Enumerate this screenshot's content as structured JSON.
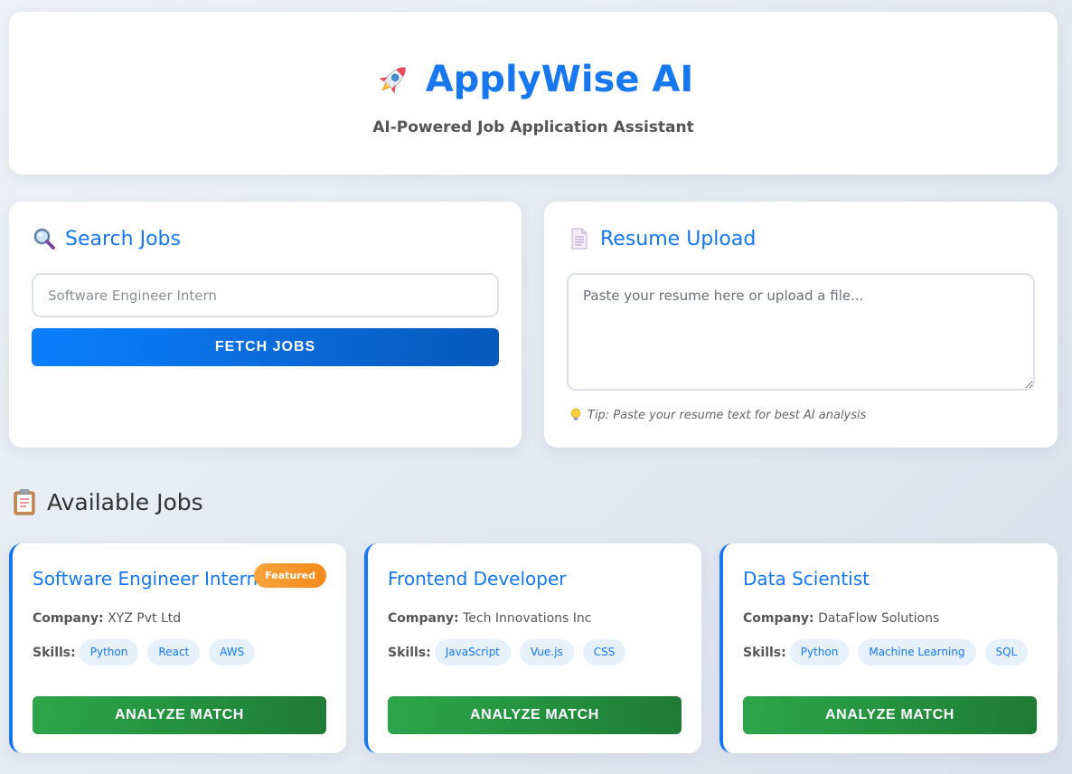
{
  "header": {
    "title": "ApplyWise AI",
    "subtitle": "AI-Powered Job Application Assistant",
    "icon": "rocket-icon"
  },
  "search": {
    "title": "Search Jobs",
    "icon": "magnifier-icon",
    "placeholder": "Software Engineer Intern",
    "value": "",
    "button_label": "FETCH JOBS"
  },
  "resume": {
    "title": "Resume Upload",
    "icon": "document-icon",
    "placeholder": "Paste your resume here or upload a file...",
    "tip": "Tip: Paste your resume text for best AI analysis",
    "tip_icon": "lightbulb-icon"
  },
  "jobs": {
    "heading": "Available Jobs",
    "icon": "clipboard-icon",
    "company_label": "Company:",
    "skills_label": "Skills:",
    "button_label": "ANALYZE MATCH",
    "items": [
      {
        "title": "Software Engineer Intern",
        "badge": "Featured",
        "company": "XYZ Pvt Ltd",
        "skills": [
          "Python",
          "React",
          "AWS"
        ]
      },
      {
        "title": "Frontend Developer",
        "company": "Tech Innovations Inc",
        "skills": [
          "JavaScript",
          "Vue.js",
          "CSS"
        ]
      },
      {
        "title": "Data Scientist",
        "company": "DataFlow Solutions",
        "skills": [
          "Python",
          "Machine Learning",
          "SQL"
        ]
      }
    ]
  },
  "colors": {
    "accent": "#1677ee",
    "success": "#28a745",
    "featured": "#f7a43b"
  }
}
